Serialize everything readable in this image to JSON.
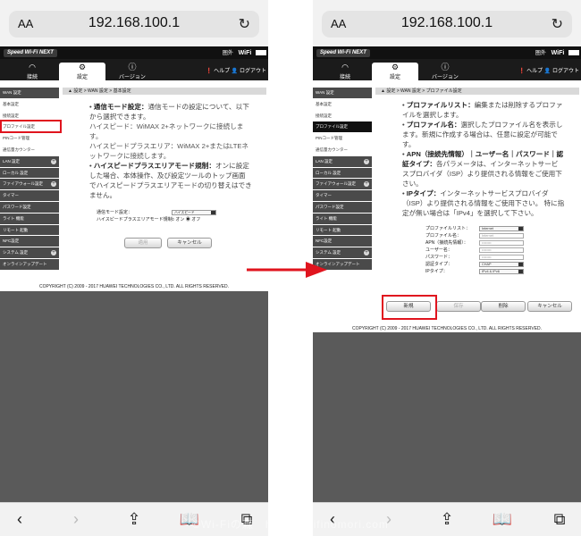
{
  "browser": {
    "text_size_label": "AA",
    "url": "192.168.100.1",
    "reload_icon": "reload-icon",
    "toolbar_icons": [
      "back-icon",
      "forward-icon",
      "share-icon",
      "bookmarks-icon",
      "tabs-icon"
    ]
  },
  "router": {
    "brand": "Speed Wi-Fi NEXT",
    "signal_label": "圏外",
    "wifi_label": "WiFi",
    "tabs": [
      {
        "icon": "wifi-icon",
        "label": "接続"
      },
      {
        "icon": "gear-icon",
        "label": "設定"
      },
      {
        "icon": "info-icon",
        "label": "バージョン"
      }
    ],
    "help_label": "ヘルプ",
    "logout_label": "ログアウト",
    "copyright": "COPYRIGHT (C) 2009 - 2017 HUAWEI TECHNOLOGIES CO., LTD. ALL RIGHTS RESERVED."
  },
  "left": {
    "sidebar": [
      {
        "label": "WAN 設定",
        "style": "dark",
        "expandable": false
      },
      {
        "label": "基本設定",
        "style": "light",
        "expandable": false
      },
      {
        "label": "接続設定",
        "style": "light",
        "expandable": false
      },
      {
        "label": "プロファイル設定",
        "style": "light",
        "expandable": false
      },
      {
        "label": "PINコード管理",
        "style": "light",
        "expandable": false
      },
      {
        "label": "通信量カウンター",
        "style": "light",
        "expandable": false
      },
      {
        "label": "LAN 設定",
        "style": "dark",
        "expandable": true
      },
      {
        "label": "ローカル 設定",
        "style": "dark",
        "expandable": false
      },
      {
        "label": "ファイアウォール設定",
        "style": "dark",
        "expandable": true
      },
      {
        "label": "タイマー",
        "style": "dark",
        "expandable": false
      },
      {
        "label": "パスワード設定",
        "style": "dark",
        "expandable": false
      },
      {
        "label": "ライト 機能",
        "style": "dark",
        "expandable": false
      },
      {
        "label": "リモート 起動",
        "style": "dark",
        "expandable": false
      },
      {
        "label": "NFC設定",
        "style": "dark",
        "expandable": false
      },
      {
        "label": "システム 設定",
        "style": "dark",
        "expandable": true
      },
      {
        "label": "オンラインアップデート",
        "style": "dark",
        "expandable": false
      }
    ],
    "breadcrumb": "設定 > WAN 設定 > 基本設定",
    "description": [
      {
        "title": "通信モード設定：",
        "text": "通信モードの設定について、以下から選択できます。"
      },
      {
        "title": "",
        "text": "ハイスピード：WiMAX 2+ネットワークに接続します。"
      },
      {
        "title": "",
        "text": "ハイスピードプラスエリア：WiMAX 2+またはLTEネットワークに接続します。"
      },
      {
        "title": "ハイスピードプラスエリアモード規制：",
        "text": "オンに設定した場合、本体操作、及び設定ツールのトップ画面でハイスピードプラスエリアモードの切り替えはできません。"
      }
    ],
    "form": {
      "mode_label": "通信モード設定：",
      "mode_value": "ハイスピード",
      "restrict_label": "ハイスピードプラスエリアモード規制：",
      "on_label": "オン",
      "off_label": "オフ"
    },
    "apply_label": "適用",
    "cancel_label": "キャンセル"
  },
  "right": {
    "sidebar": [
      {
        "label": "WAN 設定",
        "style": "dark",
        "expandable": false
      },
      {
        "label": "基本設定",
        "style": "light",
        "expandable": false
      },
      {
        "label": "接続設定",
        "style": "light",
        "expandable": false
      },
      {
        "label": "プロファイル設定",
        "style": "selected",
        "expandable": false
      },
      {
        "label": "PINコード管理",
        "style": "light",
        "expandable": false
      },
      {
        "label": "通信量カウンター",
        "style": "light",
        "expandable": false
      },
      {
        "label": "LAN 設定",
        "style": "dark",
        "expandable": true
      },
      {
        "label": "ローカル 設定",
        "style": "dark",
        "expandable": false
      },
      {
        "label": "ファイアウォール設定",
        "style": "dark",
        "expandable": true
      },
      {
        "label": "タイマー",
        "style": "dark",
        "expandable": false
      },
      {
        "label": "パスワード設定",
        "style": "dark",
        "expandable": false
      },
      {
        "label": "ライト 機能",
        "style": "dark",
        "expandable": false
      },
      {
        "label": "リモート 起動",
        "style": "dark",
        "expandable": false
      },
      {
        "label": "NFC設定",
        "style": "dark",
        "expandable": false
      },
      {
        "label": "システム 設定",
        "style": "dark",
        "expandable": true
      },
      {
        "label": "オンラインアップデート",
        "style": "dark",
        "expandable": false
      }
    ],
    "breadcrumb": "設定 > WAN 設定 > プロファイル設定",
    "description": [
      {
        "title": "プロファイルリスト：",
        "text": "編集または削除するプロファイルを選択します。"
      },
      {
        "title": "プロファイル名：",
        "text": "選択したプロファイル名を表示します。新規に作成する場合は、任意に設定が可能です。"
      },
      {
        "title": "APN（接続先情報）｜ユーザー名｜パスワード｜認証タイプ：",
        "text": "各パラメータは、インターネットサービスプロバイダ（ISP）より提供される情報をご使用下さい。"
      },
      {
        "title": "IPタイプ：",
        "text": "インターネットサービスプロバイダ（ISP）より提供される情報をご使用下さい。 特に指定が無い場合は「IPv4」を選択して下さい。"
      }
    ],
    "form": [
      {
        "label": "プロファイルリスト：",
        "kind": "select",
        "value": "Internet"
      },
      {
        "label": "プロファイル名：",
        "kind": "input",
        "value": "Internet"
      },
      {
        "label": "APN（接続先情報）：",
        "kind": "input",
        "value": "••••••••"
      },
      {
        "label": "ユーザー名：",
        "kind": "input",
        "value": "••••••••"
      },
      {
        "label": "パスワード：",
        "kind": "input",
        "value": "••••••••"
      },
      {
        "label": "認証タイプ：",
        "kind": "select",
        "value": "CHAP"
      },
      {
        "label": "IPタイプ：",
        "kind": "select",
        "value": "IPv4 & IPv6"
      }
    ],
    "new_label": "新規",
    "save_label": "保存",
    "delete_label": "削除",
    "cancel_label": "キャンセル"
  },
  "annotations": {
    "highlight_color": "#e0141e",
    "arrow_color": "#e0141e"
  },
  "watermark": "©Wi-Fiの森　https://wifinomori.com"
}
